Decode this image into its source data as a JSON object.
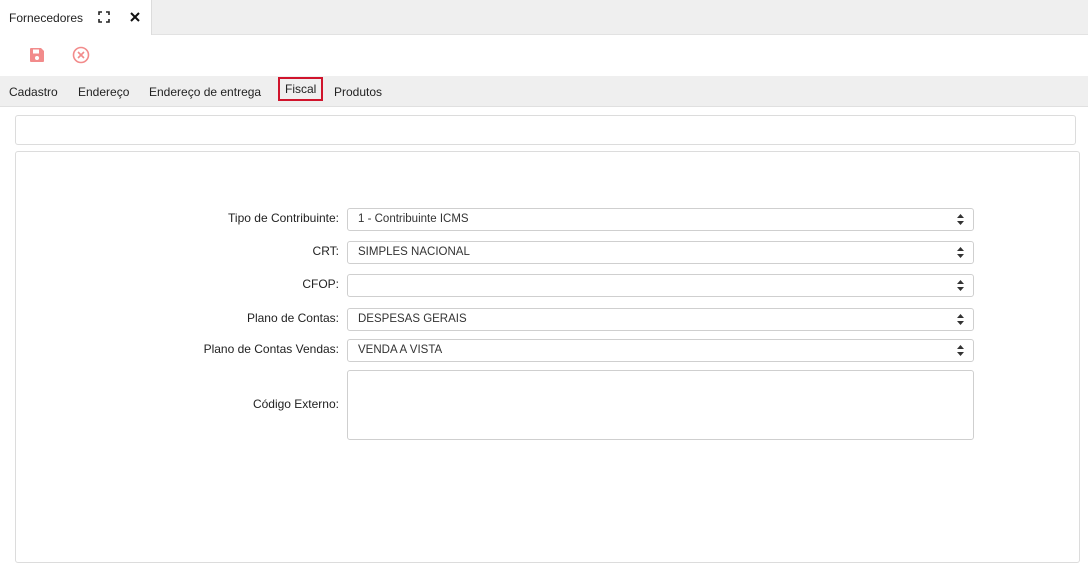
{
  "tab": {
    "title": "Fornecedores"
  },
  "subtabs": [
    "Cadastro",
    "Endereço",
    "Endereço de entrega",
    "Fiscal",
    "Produtos"
  ],
  "form": {
    "tipo_contribuinte": {
      "label": "Tipo de Contribuinte:",
      "value": "1 - Contribuinte ICMS"
    },
    "crt": {
      "label": "CRT:",
      "value": "SIMPLES NACIONAL"
    },
    "cfop": {
      "label": "CFOP:",
      "value": ""
    },
    "plano_contas": {
      "label": "Plano de Contas:",
      "value": "DESPESAS GERAIS"
    },
    "plano_contas_vendas": {
      "label": "Plano de Contas Vendas:",
      "value": "VENDA A VISTA"
    },
    "codigo_externo": {
      "label": "Código Externo:",
      "value": ""
    }
  },
  "colors": {
    "accent": "#d0142c",
    "icon": "#f28b8b"
  },
  "icons": {
    "expand": "expand-icon",
    "close": "close-icon",
    "save": "save-icon",
    "cancel": "cancel-icon",
    "caret": "sort-caret-icon"
  }
}
